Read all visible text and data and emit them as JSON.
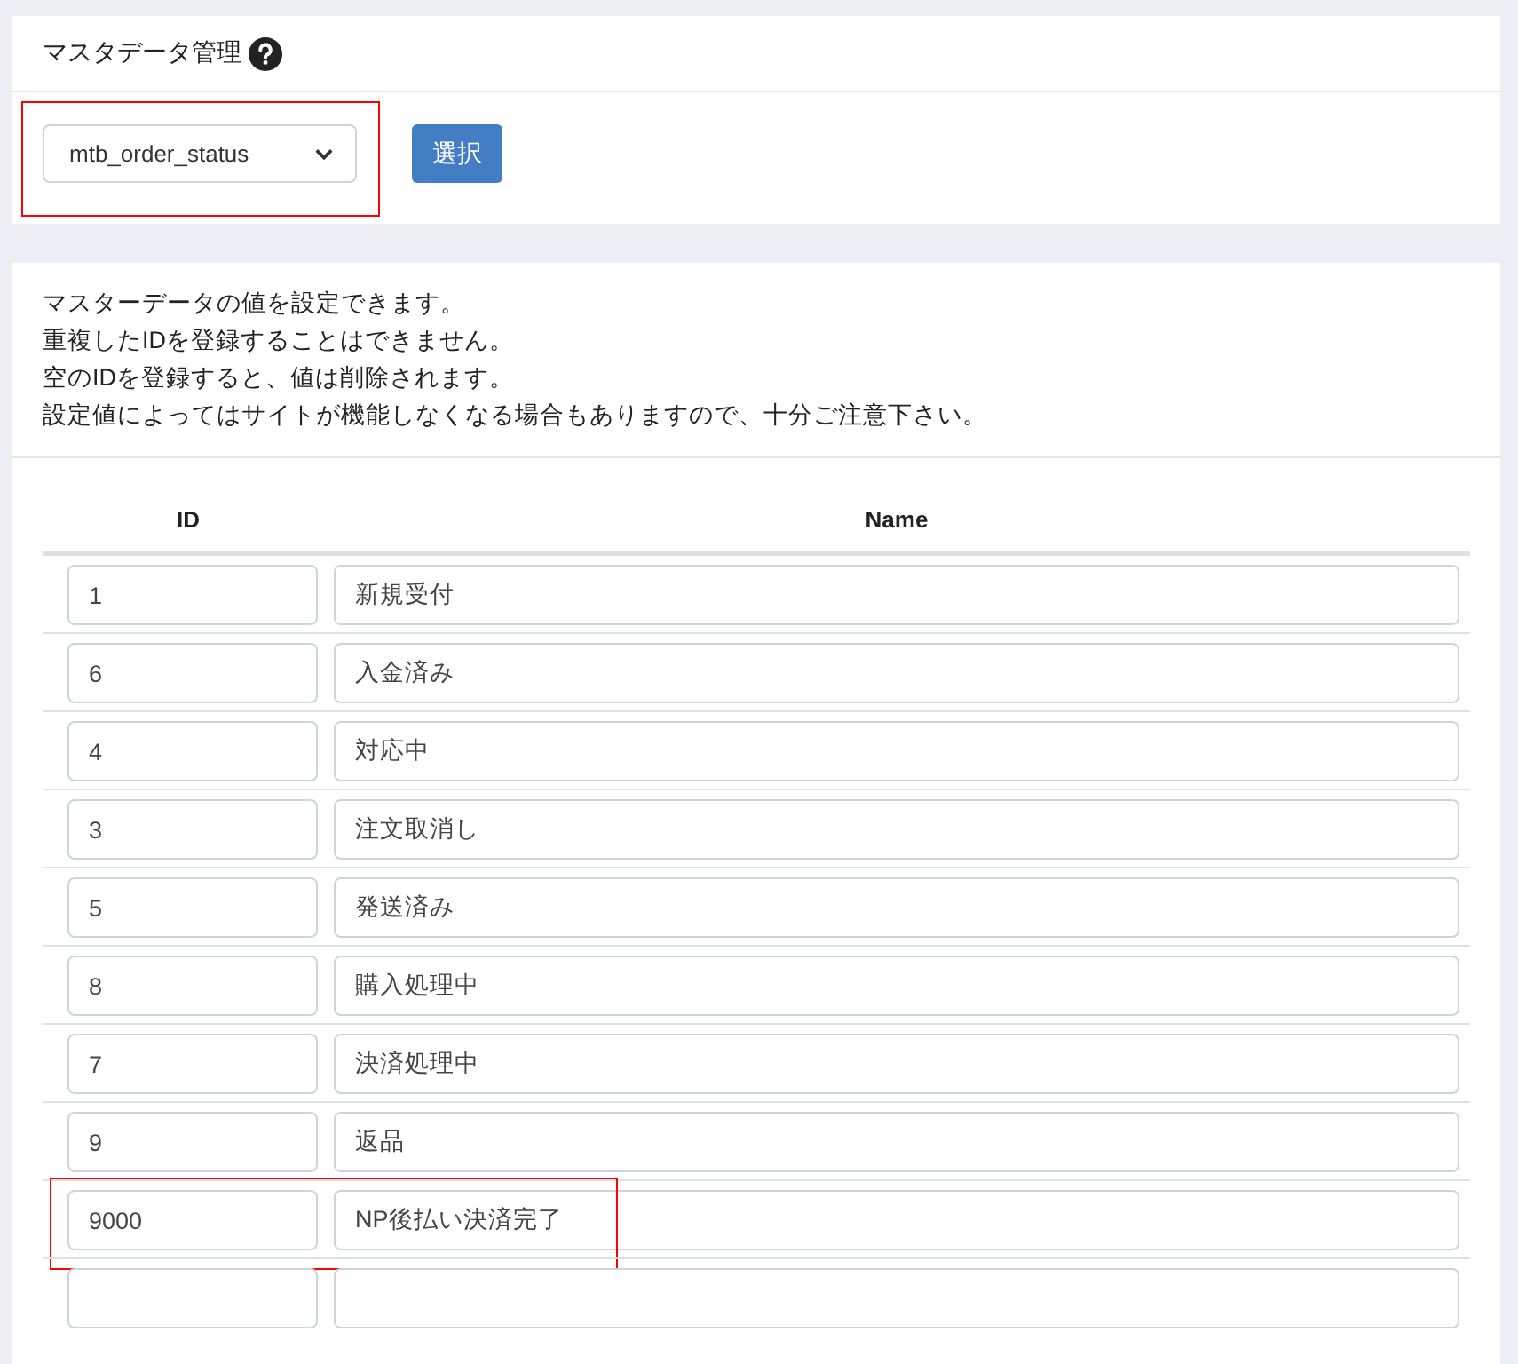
{
  "header": {
    "title": "マスタデータ管理"
  },
  "selector": {
    "value": "mtb_order_status",
    "highlighted": true,
    "button": "選択"
  },
  "notes": [
    "マスターデータの値を設定できます。",
    "重複したIDを登録することはできません。",
    "空のIDを登録すると、値は削除されます。",
    "設定値によってはサイトが機能しなくなる場合もありますので、十分ご注意下さい。"
  ],
  "table": {
    "columns": [
      "ID",
      "Name"
    ],
    "rows": [
      {
        "kind": "entry",
        "id": "1",
        "name": "新規受付",
        "highlighted": false
      },
      {
        "kind": "entry",
        "id": "6",
        "name": "入金済み",
        "highlighted": false
      },
      {
        "kind": "entry",
        "id": "4",
        "name": "対応中",
        "highlighted": false
      },
      {
        "kind": "entry",
        "id": "3",
        "name": "注文取消し",
        "highlighted": false
      },
      {
        "kind": "entry",
        "id": "5",
        "name": "発送済み",
        "highlighted": false
      },
      {
        "kind": "entry",
        "id": "8",
        "name": "購入処理中",
        "highlighted": false
      },
      {
        "kind": "entry",
        "id": "7",
        "name": "決済処理中",
        "highlighted": false
      },
      {
        "kind": "entry",
        "id": "9",
        "name": "返品",
        "highlighted": false
      },
      {
        "kind": "entry",
        "id": "9000",
        "name": "NP後払い決済完了",
        "highlighted": true
      },
      {
        "kind": "empty",
        "highlighted": false
      }
    ]
  }
}
